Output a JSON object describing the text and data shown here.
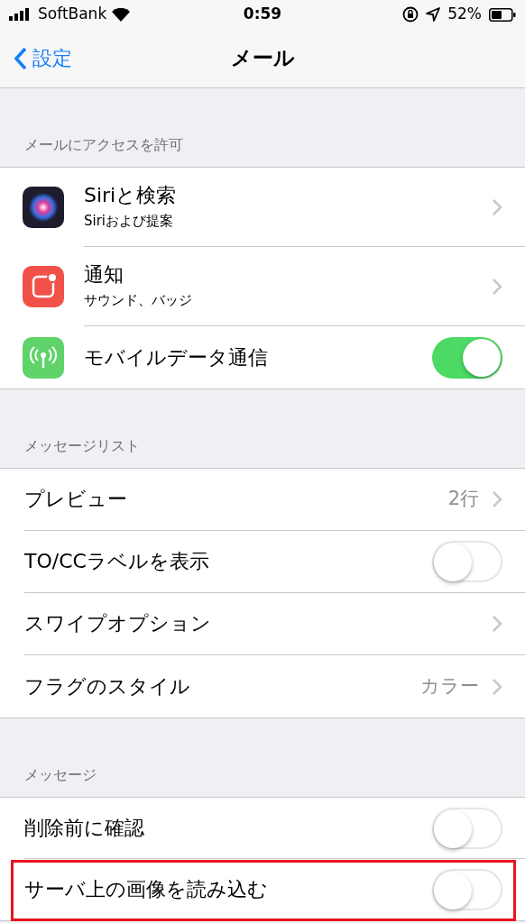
{
  "status_bar": {
    "carrier": "SoftBank",
    "time": "0:59",
    "battery": "52%"
  },
  "nav": {
    "back": "設定",
    "title": "メール"
  },
  "sections": [
    {
      "header": "メールにアクセスを許可",
      "rows": [
        {
          "kind": "nav",
          "title": "Siriと検索",
          "subtitle": "Siriおよび提案",
          "highlighted": false
        },
        {
          "kind": "nav",
          "title": "通知",
          "subtitle": "サウンド、バッジ",
          "highlighted": false
        },
        {
          "kind": "toggle",
          "title": "モバイルデータ通信",
          "on": true,
          "highlighted": false
        }
      ]
    },
    {
      "header": "メッセージリスト",
      "rows": [
        {
          "kind": "nav",
          "title": "プレビュー",
          "detail": "2行",
          "highlighted": false
        },
        {
          "kind": "toggle",
          "title": "TO/CCラベルを表示",
          "on": false,
          "highlighted": false
        },
        {
          "kind": "nav",
          "title": "スワイプオプション",
          "highlighted": false
        },
        {
          "kind": "nav",
          "title": "フラグのスタイル",
          "detail": "カラー",
          "highlighted": false
        }
      ]
    },
    {
      "header": "メッセージ",
      "rows": [
        {
          "kind": "toggle",
          "title": "削除前に確認",
          "on": false,
          "highlighted": false
        },
        {
          "kind": "toggle",
          "title": "サーバ上の画像を読み込む",
          "on": false,
          "highlighted": true
        }
      ]
    }
  ]
}
